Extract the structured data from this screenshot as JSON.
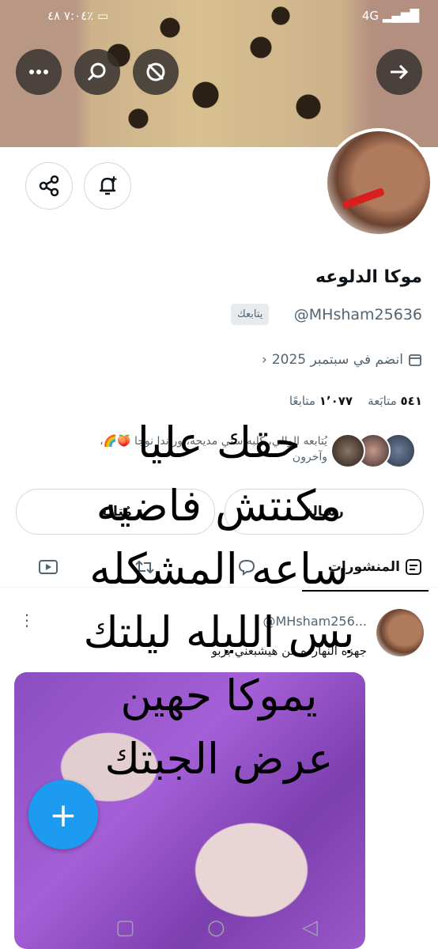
{
  "status_bar": {
    "time": "٧:٠٤",
    "battery": "٤٨٪",
    "signal": "4G"
  },
  "profile": {
    "display_name": "موكا الدلوعه",
    "handle": "@MHsham25636",
    "follows_you_badge": "يتابعك",
    "joined": "انضم في سبتمبر 2025",
    "following_count": "٥٤١",
    "following_label": "متابَعة",
    "followers_count": "١٬٠٧٧",
    "followers_label": "متابعًا",
    "followed_by_text": "يُتابعه الوالي، كلبه ستي مديحه، وراندا نوجا 🍑🌈،",
    "followed_by_text_2": "وآخرون"
  },
  "actions": {
    "message_label": "رسالة",
    "follow_label": "مُتابَع"
  },
  "tabs": [
    {
      "label": "المنشورات"
    }
  ],
  "post": {
    "handle": "@MHsham256...",
    "text": "جهزه النهارده  من هيشبعني بزبو"
  },
  "overlay_text": [
    "حقك عليا",
    "مكنتش فاضيه",
    "ساعه المشكله",
    "بس الليله ليلتك",
    "يموكا حهين",
    "عرض الجبتك"
  ],
  "colors": {
    "accent": "#1d9bf0",
    "muted": "#536471",
    "text": "#0f1419"
  },
  "icons": [
    "more-icon",
    "search-icon",
    "retweet-off-icon",
    "forward-arrow-icon",
    "share-icon",
    "notification-add-icon",
    "calendar-icon",
    "posts-tab-icon",
    "reply-icon",
    "repost-icon",
    "media-icon",
    "compose-icon"
  ]
}
